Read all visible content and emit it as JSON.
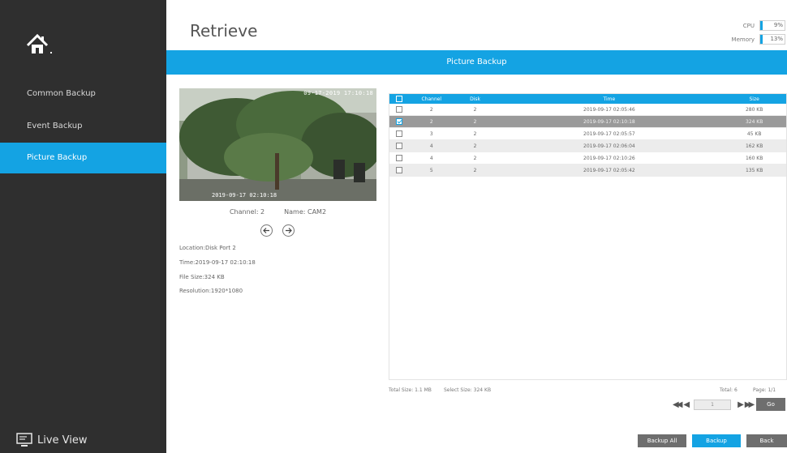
{
  "page": {
    "title": "Retrieve"
  },
  "monitor": {
    "cpu_label": "CPU",
    "cpu_value": "9%",
    "memory_label": "Memory",
    "memory_value": "13%"
  },
  "banner": {
    "title": "Picture Backup"
  },
  "sidebar": {
    "items": [
      {
        "label": "Common Backup",
        "active": false
      },
      {
        "label": "Event Backup",
        "active": false
      },
      {
        "label": "Picture Backup",
        "active": true
      }
    ],
    "live_view_label": "Live View"
  },
  "preview": {
    "overlay_timestamp": "09-17-2019 17:10:18",
    "caption": "2019-09-17 02:10:18",
    "channel": "Channel: 2",
    "name": "Name: CAM2",
    "location": "Location:Disk Port 2",
    "time": "Time:2019-09-17 02:10:18",
    "file_size": "File Size:324 KB",
    "resolution": "Resolution:1920*1080"
  },
  "table": {
    "headers": {
      "channel": "Channel",
      "disk": "Disk",
      "time": "Time",
      "size": "Size"
    },
    "rows": [
      {
        "channel": "2",
        "disk": "2",
        "time": "2019-09-17 02:05:46",
        "size": "280 KB",
        "checked": false,
        "selected": false
      },
      {
        "channel": "2",
        "disk": "2",
        "time": "2019-09-17 02:10:18",
        "size": "324 KB",
        "checked": true,
        "selected": true
      },
      {
        "channel": "3",
        "disk": "2",
        "time": "2019-09-17 02:05:57",
        "size": "45 KB",
        "checked": false,
        "selected": false
      },
      {
        "channel": "4",
        "disk": "2",
        "time": "2019-09-17 02:06:04",
        "size": "162 KB",
        "checked": false,
        "selected": false
      },
      {
        "channel": "4",
        "disk": "2",
        "time": "2019-09-17 02:10:26",
        "size": "160 KB",
        "checked": false,
        "selected": false
      },
      {
        "channel": "5",
        "disk": "2",
        "time": "2019-09-17 02:05:42",
        "size": "135 KB",
        "checked": false,
        "selected": false
      }
    ]
  },
  "footer": {
    "total_size": "Total Size: 1.1 MB",
    "select_size": "Select Size: 324 KB",
    "total": "Total: 6",
    "page": "Page: 1/1",
    "page_input": "1",
    "go_label": "Go",
    "backup_all_label": "Backup All",
    "backup_label": "Backup",
    "back_label": "Back"
  },
  "colors": {
    "accent": "#14a3e3",
    "sidebar": "#2f2f2f",
    "selected_row": "#9a9a9a"
  }
}
